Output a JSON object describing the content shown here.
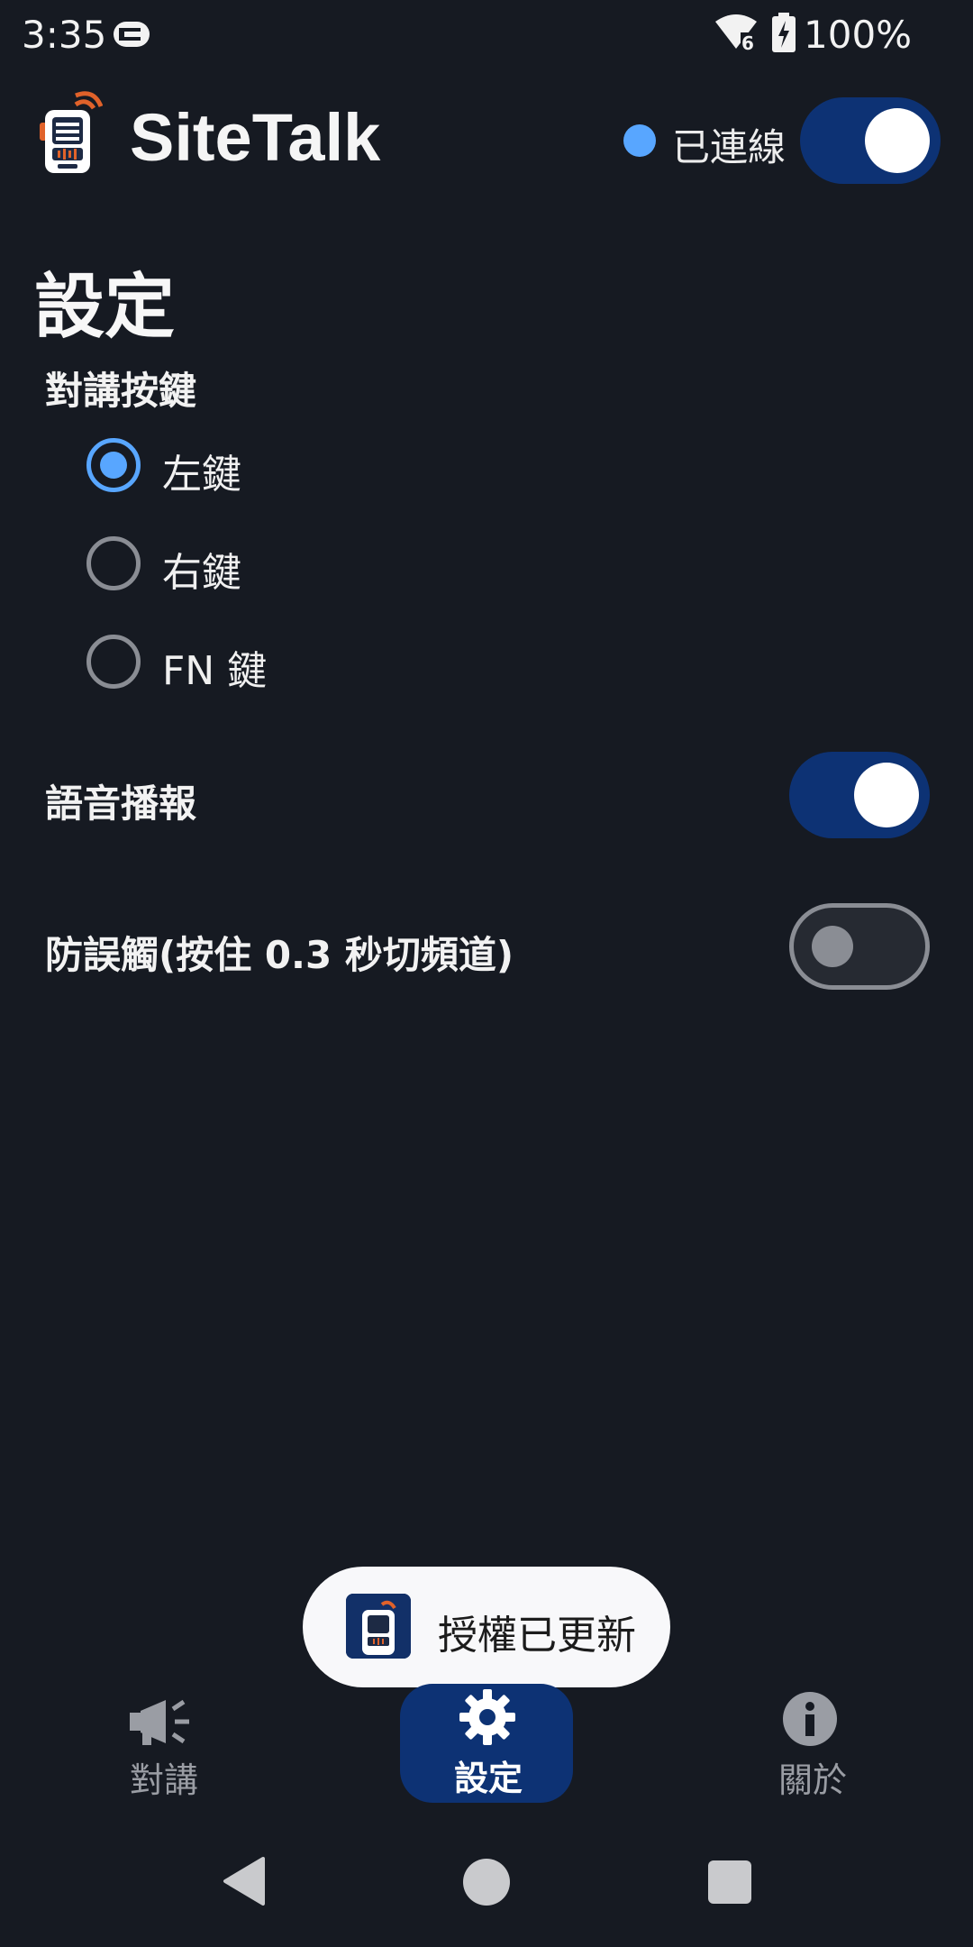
{
  "status_bar": {
    "time": "3:35",
    "battery": "100%",
    "wifi_badge": "6",
    "icons": [
      "notification-icon",
      "wifi-icon",
      "battery-charging-icon"
    ]
  },
  "app_bar": {
    "title": "SiteTalk",
    "connection_status": "已連線",
    "connection_dot_color": "#58a6ff",
    "connection_switch_on": true
  },
  "settings": {
    "page_title": "設定",
    "ptt_key": {
      "label": "對講按鍵",
      "options": [
        {
          "label": "左鍵",
          "selected": true
        },
        {
          "label": "右鍵",
          "selected": false
        },
        {
          "label": "FN 鍵",
          "selected": false
        }
      ]
    },
    "voice_announce": {
      "label": "語音播報",
      "on": true
    },
    "anti_mistouch": {
      "label": "防誤觸(按住 0.3 秒切頻道)",
      "on": false
    }
  },
  "toast": {
    "text": "授權已更新"
  },
  "bottom_nav": {
    "items": [
      {
        "label": "對講",
        "icon": "megaphone-icon",
        "active": false
      },
      {
        "label": "設定",
        "icon": "gear-icon",
        "active": true
      },
      {
        "label": "關於",
        "icon": "info-icon",
        "active": false
      }
    ]
  },
  "colors": {
    "background": "#161a22",
    "accent": "#58a6ff",
    "active_nav": "#0d3274"
  }
}
